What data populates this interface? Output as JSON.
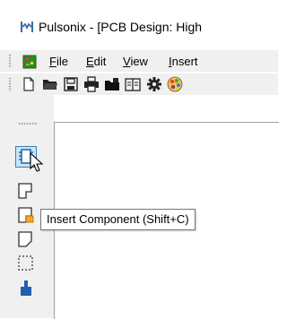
{
  "window": {
    "title": "Pulsonix - [PCB Design: High",
    "app_icon": "pulsonix-logo-icon"
  },
  "menubar": {
    "items": [
      {
        "label": "File",
        "mnemonic": "F",
        "rest": "ile"
      },
      {
        "label": "Edit",
        "mnemonic": "E",
        "rest": "dit"
      },
      {
        "label": "View",
        "mnemonic": "V",
        "rest": "iew"
      },
      {
        "label": "Insert",
        "mnemonic": "I",
        "rest": "nsert"
      }
    ]
  },
  "toolbar": {
    "buttons": [
      "new-document-icon",
      "open-folder-icon",
      "save-icon",
      "print-icon",
      "open-recent-icon",
      "library-book-icon",
      "settings-gear-icon",
      "color-palette-icon"
    ]
  },
  "left_toolbar": {
    "buttons": [
      "insert-component-icon",
      "insert-component-alt-icon",
      "insert-component-orange-icon",
      "insert-outline-icon",
      "selection-box-icon",
      "insert-pin-icon"
    ]
  },
  "tooltip": {
    "text": "Insert Component (Shift+C)"
  },
  "colors": {
    "chrome": "#f0f0f0",
    "canvas": "#ffffff",
    "accent_blue": "#1f5fb0",
    "accent_orange": "#f5a623"
  }
}
